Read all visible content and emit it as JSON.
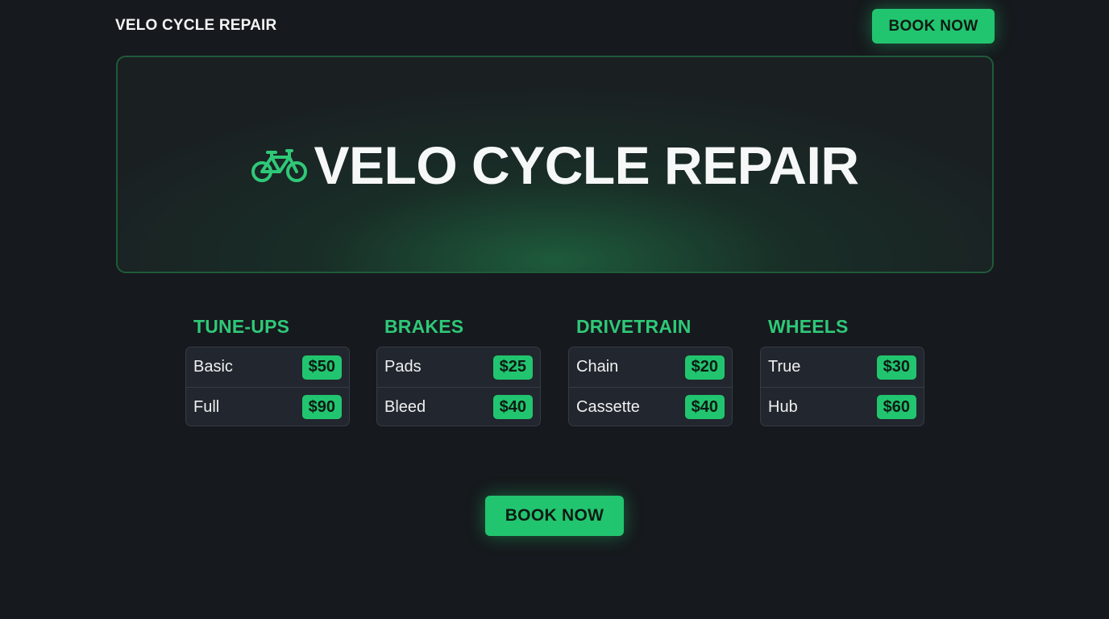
{
  "header": {
    "brand": "VELO CYCLE REPAIR",
    "book_label": "BOOK NOW"
  },
  "hero": {
    "icon": "bicycle-icon",
    "title": "VELO CYCLE REPAIR"
  },
  "categories": [
    {
      "title": "TUNE-UPS",
      "items": [
        {
          "name": "Basic",
          "price": "$50"
        },
        {
          "name": "Full",
          "price": "$90"
        }
      ]
    },
    {
      "title": "BRAKES",
      "items": [
        {
          "name": "Pads",
          "price": "$25"
        },
        {
          "name": "Bleed",
          "price": "$40"
        }
      ]
    },
    {
      "title": "DRIVETRAIN",
      "items": [
        {
          "name": "Chain",
          "price": "$20"
        },
        {
          "name": "Cassette",
          "price": "$40"
        }
      ]
    },
    {
      "title": "WHEELS",
      "items": [
        {
          "name": "True",
          "price": "$30"
        },
        {
          "name": "Hub",
          "price": "$60"
        }
      ]
    }
  ],
  "cta": {
    "book_label": "BOOK NOW"
  },
  "colors": {
    "accent": "#22c56f",
    "background": "#16191d",
    "card": "#22262e"
  }
}
